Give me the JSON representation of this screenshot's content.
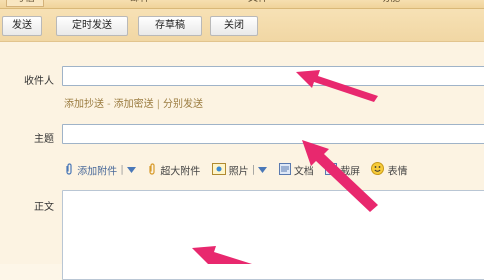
{
  "tabs": [
    "写信",
    "邮件",
    "文件",
    "功能"
  ],
  "toolbar": {
    "send": "发送",
    "scheduled_send": "定时发送",
    "save_draft": "存草稿",
    "close": "关闭"
  },
  "recipient": {
    "label": "收件人",
    "value": ""
  },
  "recipient_links": {
    "cc": "添加抄送",
    "dash": "-",
    "bcc": "添加密送",
    "pipe": "|",
    "separate": "分别发送"
  },
  "subject": {
    "label": "主题",
    "value": ""
  },
  "attach_toolbar": {
    "add_attachment": "添加附件",
    "large_attachment": "超大附件",
    "photo": "照片",
    "doc": "文档",
    "screenshot": "截屏",
    "emoji": "表情"
  },
  "body": {
    "label": "正文",
    "value": ""
  },
  "colors": {
    "accent_arrow": "#e8286e",
    "link": "#9a7b3f",
    "toolbar": "#f4dca8"
  }
}
